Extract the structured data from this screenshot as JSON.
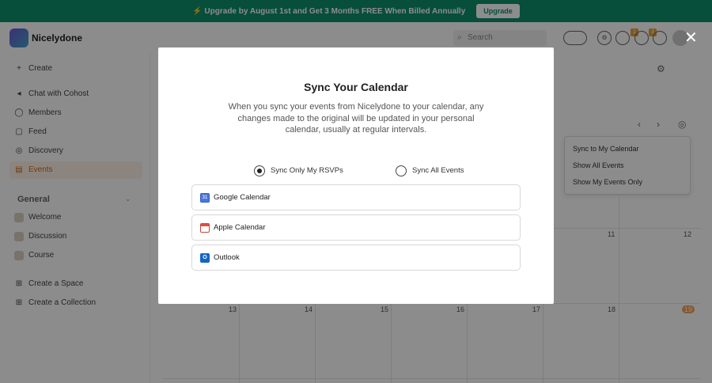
{
  "banner": {
    "text": "⚡ Upgrade by August 1st and Get 3 Months FREE When Billed Annually",
    "button": "Upgrade"
  },
  "header": {
    "brand": "Nicelydone",
    "search_placeholder": "Search",
    "badge_a": "1",
    "badge_b": "3"
  },
  "sidebar": {
    "create": "Create",
    "items": [
      {
        "label": "Chat with Cohost",
        "icon": "chat-icon"
      },
      {
        "label": "Members",
        "icon": "members-icon"
      },
      {
        "label": "Feed",
        "icon": "feed-icon"
      },
      {
        "label": "Discovery",
        "icon": "compass-icon"
      },
      {
        "label": "Events",
        "icon": "calendar-icon"
      }
    ],
    "section": "General",
    "spaces": [
      "Welcome",
      "Discussion",
      "Course"
    ],
    "create_space": "Create a Space",
    "create_collection": "Create a Collection"
  },
  "calendar": {
    "dropdown": [
      "Sync to My Calendar",
      "Show All Events",
      "Show My Events Only"
    ],
    "days_row1": [
      "11",
      "12"
    ],
    "days_row2": [
      "13",
      "14",
      "15",
      "16",
      "17",
      "18",
      "19"
    ]
  },
  "modal": {
    "title": "Sync Your Calendar",
    "description": "When you sync your events from Nicelydone to your calendar, any changes made to the original will be updated in your personal calendar, usually at regular intervals.",
    "radio_rsvps": "Sync Only My RSVPs",
    "radio_all": "Sync All Events",
    "selected": "Sync Only My RSVPs",
    "options": [
      "Google Calendar",
      "Apple Calendar",
      "Outlook"
    ]
  },
  "colors": {
    "accent": "#0e8f6c",
    "overlay": "rgba(0,0,0,0.45)"
  }
}
